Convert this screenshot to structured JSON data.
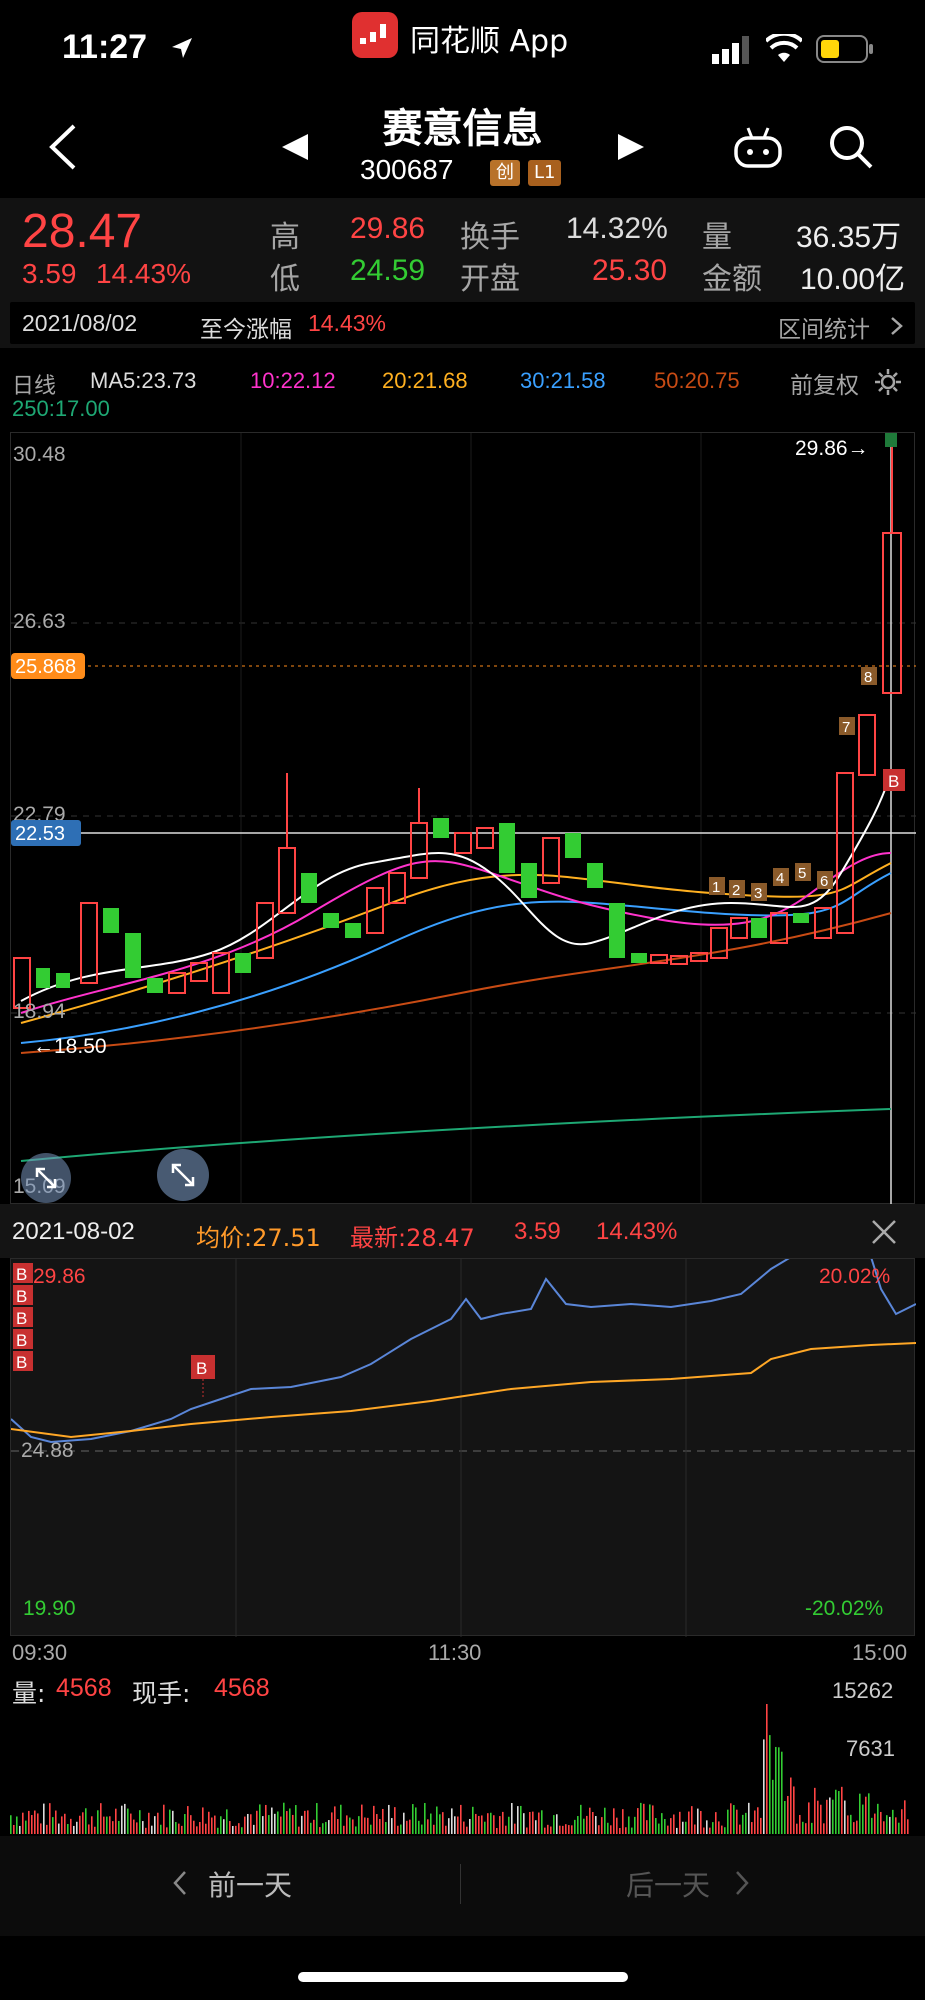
{
  "status": {
    "time": "11:27",
    "app_name": "同花顺 App"
  },
  "nav": {
    "title": "赛意信息",
    "code": "300687",
    "tag1": "创",
    "tag2": "L1"
  },
  "quote": {
    "price": "28.47",
    "change": "3.59",
    "change_pct": "14.43%",
    "high_label": "高",
    "high": "29.86",
    "low_label": "低",
    "low": "24.59",
    "turnover_label": "换手",
    "turnover": "14.32%",
    "open_label": "开盘",
    "open": "25.30",
    "volume_label": "量",
    "volume": "36.35万",
    "amount_label": "金额",
    "amount": "10.00亿"
  },
  "date_bar": {
    "date": "2021/08/02",
    "since_label": "至今涨幅",
    "since_pct": "14.43%",
    "stat_label": "区间统计"
  },
  "ma": {
    "period": "日线",
    "ma5": "MA5:23.73",
    "ma10": "10:22.12",
    "ma20": "20:21.68",
    "ma30": "30:21.58",
    "ma50": "50:20.75",
    "ma250": "250:17.00",
    "adjust": "前复权",
    "colors": {
      "ma5": "#ffffff",
      "ma10": "#ff33cc",
      "ma20": "#ffb020",
      "ma30": "#3aa0ff",
      "ma50": "#c84b14",
      "ma250": "#1ea874"
    }
  },
  "kline": {
    "y_labels": [
      "30.48",
      "26.63",
      "22.79",
      "18.94",
      "15.09"
    ],
    "price_tag_orange": "25.868",
    "price_tag_blue": "22.53",
    "max_marker": "29.86→",
    "min_marker": "←18.50",
    "signal_markers": [
      "1",
      "2",
      "3",
      "4",
      "5",
      "6",
      "7",
      "8"
    ],
    "buy_marker": "B"
  },
  "intraday": {
    "date": "2021-08-02",
    "avg_label": "均价:27.51",
    "latest_label": "最新:28.47",
    "change": "3.59",
    "change_pct": "14.43%",
    "top_price": "29.86",
    "mid_price": "24.88",
    "bottom_price": "19.90",
    "top_pct": "20.02%",
    "bottom_pct": "-20.02%",
    "t_open": "09:30",
    "t_mid": "11:30",
    "t_close": "15:00",
    "buy_marker": "B"
  },
  "volume": {
    "vol_label": "量:",
    "vol_value": "4568",
    "hand_label": "现手:",
    "hand_value": "4568",
    "max_label": "15262",
    "mid_label": "7631"
  },
  "footer": {
    "prev": "前一天",
    "next": "后一天"
  }
}
